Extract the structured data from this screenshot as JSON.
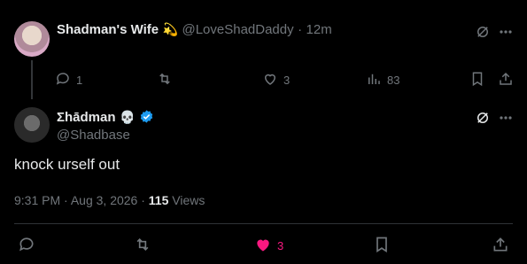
{
  "reply": {
    "display_name": "Shadman's Wife",
    "name_emoji": "💫",
    "handle": "@LoveShadDaddy",
    "separator": "·",
    "age": "12m",
    "text": "",
    "replies": "1",
    "likes": "3",
    "views": "83"
  },
  "main": {
    "display_name": "Σhādman",
    "name_emoji": "💀",
    "handle": "@Shadbase",
    "text": "knock urself out",
    "time": "9:31 PM",
    "dot": "·",
    "date": "Aug 3, 2026",
    "dot2": "·",
    "views_count": "115",
    "views_label": "Views",
    "likes": "3"
  },
  "colors": {
    "background": "#000000",
    "text": "#e7e9ea",
    "muted": "#71767b",
    "like_active": "#f91880",
    "verified": "#1d9bf0"
  }
}
